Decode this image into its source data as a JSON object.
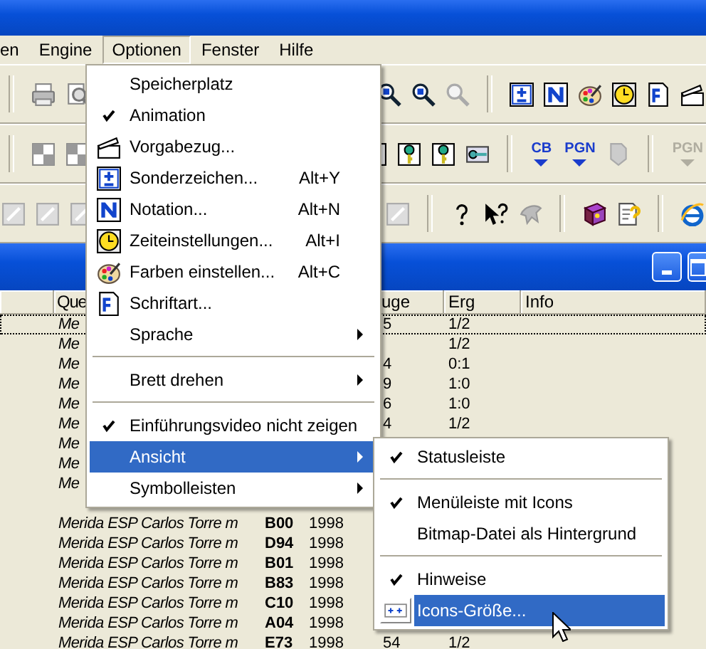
{
  "menubar": [
    {
      "label": "en",
      "selected": false
    },
    {
      "label": "Engine",
      "selected": false
    },
    {
      "label": "Optionen",
      "selected": true
    },
    {
      "label": "Fenster",
      "selected": false
    },
    {
      "label": "Hilfe",
      "selected": false
    }
  ],
  "toolbar_buttons": [
    {
      "label": "CB",
      "disabled": false
    },
    {
      "label": "PGN",
      "disabled": false
    },
    {
      "label": "PGN",
      "disabled": true
    }
  ],
  "table": {
    "header": {
      "column_2": "Que",
      "column_5": "uge",
      "column_6": "Erg",
      "column_7": "Info"
    },
    "rows": [
      {
        "selected": true,
        "column_2": "Me",
        "column_5": "5",
        "column_6": "1/2"
      },
      {
        "selected": false,
        "column_2": "Me",
        "column_6": "1/2"
      },
      {
        "selected": false,
        "column_2": "Me",
        "column_5": "4",
        "column_6": "0:1"
      },
      {
        "selected": false,
        "column_2": "Me",
        "column_5": "9",
        "column_6": "1:0"
      },
      {
        "selected": false,
        "column_2": "Me",
        "column_5": "6",
        "column_6": "1:0"
      },
      {
        "selected": false,
        "column_2": "Me",
        "column_5": "4",
        "column_6": "1/2"
      },
      {
        "selected": false,
        "column_2": "Me"
      },
      {
        "selected": false,
        "column_2": "Me"
      },
      {
        "selected": false,
        "column_2": "Me"
      },
      {
        "selected": false
      },
      {
        "selected": false,
        "column_2": "Merida ESP Carlos Torre m",
        "column_3": "B00",
        "column_4": "1998"
      },
      {
        "selected": false,
        "column_2": "Merida ESP Carlos Torre m",
        "column_3": "D94",
        "column_4": "1998"
      },
      {
        "selected": false,
        "column_2": "Merida ESP Carlos Torre m",
        "column_3": "B01",
        "column_4": "1998"
      },
      {
        "selected": false,
        "column_2": "Merida ESP Carlos Torre m",
        "column_3": "B83",
        "column_4": "1998"
      },
      {
        "selected": false,
        "column_2": "Merida ESP Carlos Torre m",
        "column_3": "C10",
        "column_4": "1998"
      },
      {
        "selected": false,
        "column_2": "Merida ESP Carlos Torre m",
        "column_3": "A04",
        "column_4": "1998"
      },
      {
        "selected": false,
        "column_2": "Merida ESP Carlos Torre m",
        "column_3": "E73",
        "column_4": "1998",
        "column_5": "54",
        "column_6": "1/2"
      }
    ]
  },
  "menu": {
    "items": [
      {
        "kind": "item",
        "label": "Speicherplatz",
        "checked": false,
        "submenu": false,
        "selected": false
      },
      {
        "kind": "item",
        "label": "Animation",
        "checked": true,
        "submenu": false,
        "selected": false
      },
      {
        "kind": "item",
        "label": "Vorgabezug...",
        "checked": false,
        "submenu": false,
        "selected": false
      },
      {
        "kind": "item",
        "label": "Sonderzeichen...",
        "shortcut": "Alt+Y",
        "checked": false,
        "submenu": false,
        "selected": false
      },
      {
        "kind": "item",
        "label": "Notation...",
        "shortcut": "Alt+N",
        "checked": false,
        "submenu": false,
        "selected": false
      },
      {
        "kind": "item",
        "label": "Zeiteinstellungen...",
        "shortcut": "Alt+I",
        "checked": false,
        "submenu": false,
        "selected": false
      },
      {
        "kind": "item",
        "label": "Farben einstellen...",
        "shortcut": "Alt+C",
        "checked": false,
        "submenu": false,
        "selected": false
      },
      {
        "kind": "item",
        "label": "Schriftart...",
        "checked": false,
        "submenu": false,
        "selected": false
      },
      {
        "kind": "item",
        "label": "Sprache",
        "checked": false,
        "submenu": true,
        "selected": false
      },
      {
        "kind": "separator"
      },
      {
        "kind": "item",
        "label": "Brett drehen",
        "checked": false,
        "submenu": true,
        "selected": false
      },
      {
        "kind": "separator"
      },
      {
        "kind": "item",
        "label": "Einführungsvideo nicht zeigen",
        "checked": true,
        "submenu": false,
        "selected": false
      },
      {
        "kind": "item",
        "label": "Ansicht",
        "checked": false,
        "submenu": true,
        "selected": true
      },
      {
        "kind": "item",
        "label": "Symbolleisten",
        "checked": false,
        "submenu": true,
        "selected": false
      }
    ]
  },
  "submenu": {
    "items": [
      {
        "kind": "item",
        "label": "Statusleiste",
        "checked": true,
        "submenu": false,
        "selected": false
      },
      {
        "kind": "separator"
      },
      {
        "kind": "item",
        "label": "Menüleiste mit Icons",
        "checked": true,
        "submenu": false,
        "selected": false
      },
      {
        "kind": "item",
        "label": "Bitmap-Datei als Hintergrund",
        "checked": false,
        "submenu": false,
        "selected": false
      },
      {
        "kind": "separator"
      },
      {
        "kind": "item",
        "label": "Hinweise",
        "checked": true,
        "submenu": false,
        "selected": false
      },
      {
        "kind": "item",
        "label": "Icons-Größe...",
        "checked": false,
        "submenu": false,
        "selected": true
      }
    ]
  }
}
